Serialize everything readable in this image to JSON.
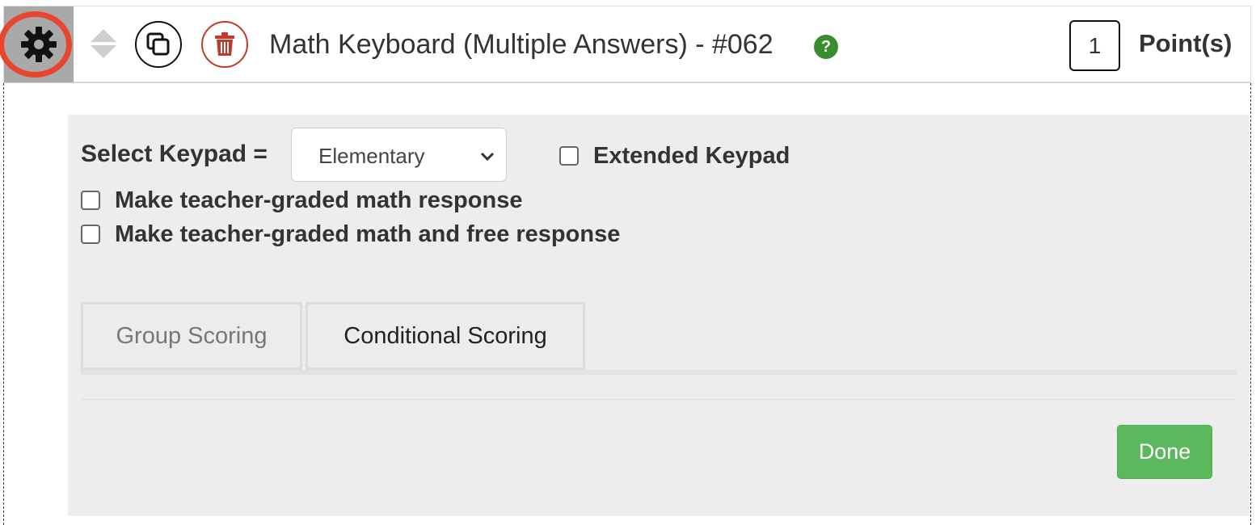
{
  "header": {
    "title": "Math Keyboard (Multiple Answers) - #062",
    "help_icon_text": "?",
    "points_value": "1",
    "points_label": "Point(s)",
    "icons": [
      "gear-icon",
      "sort-arrows-icon",
      "copy-icon",
      "trash-icon",
      "help-icon"
    ]
  },
  "settings": {
    "keypad_label": "Select Keypad =",
    "keypad_selected": "Elementary",
    "extended_keypad_label": "Extended Keypad",
    "extended_keypad_checked": false,
    "teacher_graded_math_label": "Make teacher-graded math response",
    "teacher_graded_math_checked": false,
    "teacher_graded_free_label": "Make teacher-graded math and free response",
    "teacher_graded_free_checked": false
  },
  "tabs": [
    {
      "label": "Group Scoring"
    },
    {
      "label": "Conditional Scoring"
    }
  ],
  "actions": {
    "done_label": "Done"
  },
  "colors": {
    "highlight_ring": "#e8452f",
    "done_button": "#5cb85c",
    "help_icon": "#3a8d2e",
    "delete_button": "#c0392b",
    "panel_background": "#ededed"
  }
}
